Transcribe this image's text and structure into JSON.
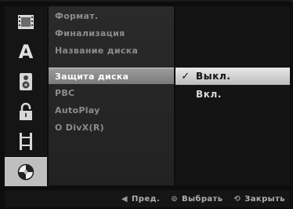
{
  "rail": {
    "items": [
      {
        "icon": "film-icon"
      },
      {
        "icon": "letter-a-icon",
        "glyph": "A"
      },
      {
        "icon": "speaker-icon"
      },
      {
        "icon": "padlock-icon"
      },
      {
        "icon": "film-strip-icon"
      },
      {
        "icon": "disc-icon",
        "active": true
      }
    ]
  },
  "menu": {
    "items": [
      {
        "label": "Формат."
      },
      {
        "label": "Финализация"
      },
      {
        "label": "Название диска"
      },
      {
        "label": "Защита диска",
        "active": true
      },
      {
        "label": "PBC"
      },
      {
        "label": "AutoPlay"
      },
      {
        "label": "О DivX(R)"
      }
    ]
  },
  "submenu": {
    "items": [
      {
        "label": "Выкл.",
        "selected": true,
        "check": "✓"
      },
      {
        "label": "Вкл."
      }
    ]
  },
  "bottombar": {
    "prev": {
      "icon": "◀",
      "label": "Пред."
    },
    "select": {
      "icon": "⊙",
      "label": "Выбрать"
    },
    "close": {
      "icon": "⟲",
      "label": "Закрыть"
    }
  }
}
